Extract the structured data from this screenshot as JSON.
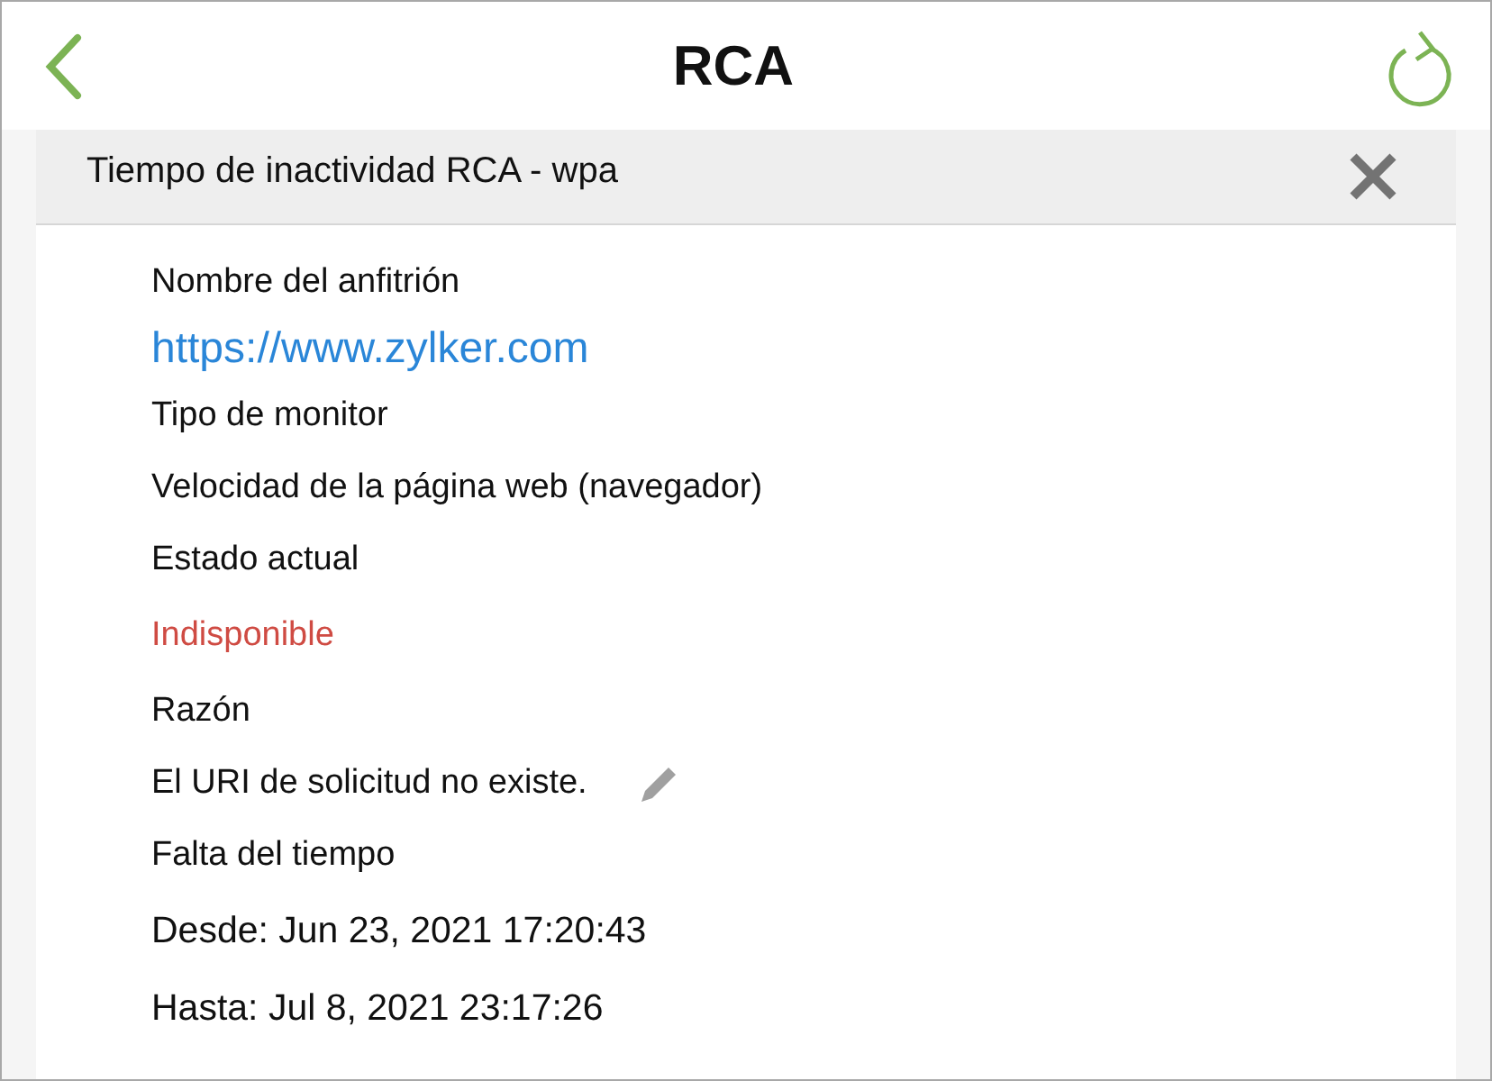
{
  "header": {
    "title": "RCA"
  },
  "panel": {
    "title": "Tiempo de inactividad RCA - wpa"
  },
  "items": [
    {
      "kind": "label",
      "text": "Nombre del anfitrión"
    },
    {
      "kind": "link",
      "text": "https://www.zylker.com"
    },
    {
      "kind": "label",
      "text": "Tipo de monitor"
    },
    {
      "kind": "label",
      "text": "Velocidad de la página web (navegador)"
    },
    {
      "kind": "label",
      "text": "Estado actual"
    },
    {
      "kind": "status",
      "text": "Indisponible"
    },
    {
      "kind": "label",
      "text": "Razón"
    },
    {
      "kind": "editable",
      "text": "El URI de solicitud no existe."
    },
    {
      "kind": "label",
      "text": "Falta del tiempo"
    },
    {
      "kind": "date",
      "text": "Desde: Jun 23, 2021 17:20:43"
    },
    {
      "kind": "date",
      "text": "Hasta: Jul 8, 2021 23:17:26"
    }
  ]
}
